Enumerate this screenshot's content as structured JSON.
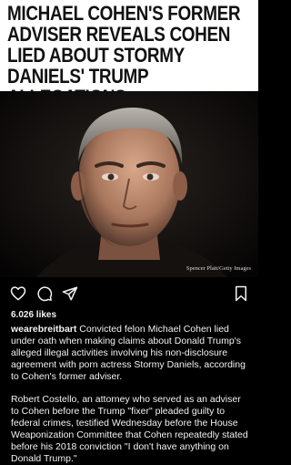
{
  "post": {
    "headline": "Michael Cohen's Former Adviser Reveals Cohen Lied About Stormy Daniels' Trump Allegations",
    "photo_credit": "Spencer Platt/Getty Images",
    "likes": "6.026 likes",
    "username": "wearebreitbart",
    "caption_1": "Convicted felon Michael Cohen lied under oath when making claims about Donald Trump's alleged illegal activities involving his non-disclosure agreement with porn actress Stormy Daniels, according to Cohen's former adviser.",
    "caption_2": "Robert Costello, an attorney who served as an adviser to Cohen before the Trump \"fixer\" pleaded guilty to federal crimes, testified Wednesday before the House Weaponization Committee that Cohen repeatedly stated before his 2018 conviction \"I don't have anything on Donald Trump.\""
  },
  "icons": [
    "heart-icon",
    "comment-icon",
    "share-icon",
    "bookmark-icon"
  ],
  "colors": {
    "background": "#000000",
    "text": "#f2f2f2",
    "headline_bg": "#ffffff",
    "headline_text": "#111111"
  }
}
